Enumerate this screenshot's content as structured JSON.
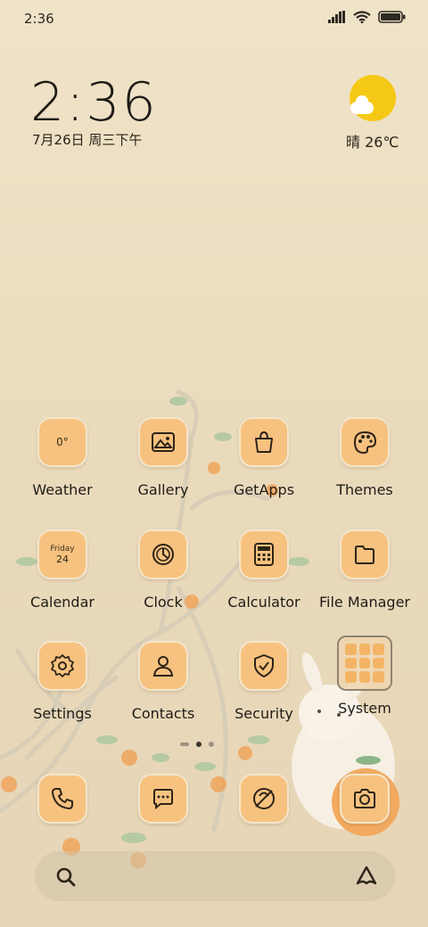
{
  "status_bar": {
    "time": "2:36"
  },
  "clock_widget": {
    "time": "2:36",
    "date": "7月26日 周三下午"
  },
  "weather_widget": {
    "condition_temp": "晴 26℃"
  },
  "apps": [
    {
      "label": "Weather",
      "tile_text": "0°"
    },
    {
      "label": "Gallery"
    },
    {
      "label": "GetApps"
    },
    {
      "label": "Themes"
    },
    {
      "label": "Calendar",
      "tile_day": "Friday",
      "tile_date": "24"
    },
    {
      "label": "Clock"
    },
    {
      "label": "Calculator"
    },
    {
      "label": "File Manager"
    },
    {
      "label": "Settings"
    },
    {
      "label": "Contacts"
    },
    {
      "label": "Security"
    },
    {
      "label": "System"
    }
  ],
  "dock": [
    "phone-icon",
    "messages-icon",
    "browser-icon",
    "camera-icon"
  ],
  "colors": {
    "tile": "#f7c27f",
    "background": "#ecdfc3",
    "sun": "#f6c816"
  }
}
